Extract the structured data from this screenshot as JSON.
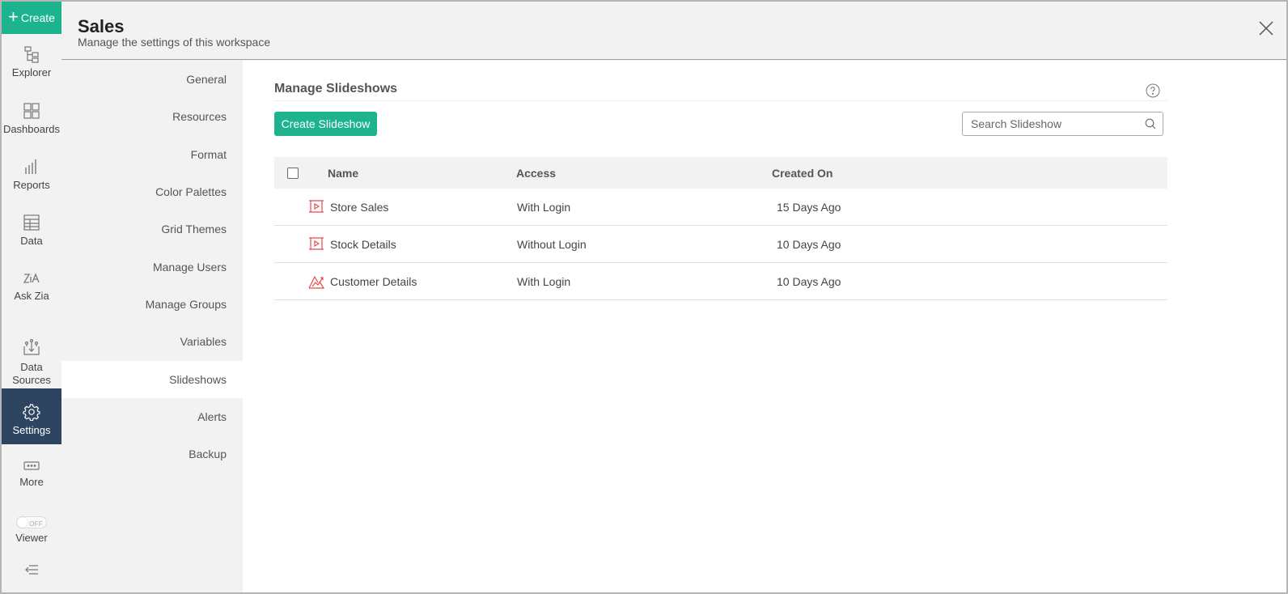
{
  "leftnav": {
    "create_label": "Create",
    "items": [
      {
        "label": "Explorer",
        "icon": "explorer-icon"
      },
      {
        "label": "Dashboards",
        "icon": "dashboards-icon"
      },
      {
        "label": "Reports",
        "icon": "reports-icon"
      },
      {
        "label": "Data",
        "icon": "data-table-icon"
      },
      {
        "label": "Ask Zia",
        "icon": "ask-zia-icon"
      },
      {
        "label": "Data Sources",
        "label_line1": "Data",
        "label_line2": "Sources",
        "icon": "data-sources-icon"
      },
      {
        "label": "Settings",
        "icon": "gear-icon",
        "active": true
      },
      {
        "label": "More",
        "icon": "more-icon"
      },
      {
        "label": "Viewer",
        "icon": "toggle-switch",
        "toggle_state": "OFF"
      }
    ],
    "collapse_icon": "collapse-menu-icon"
  },
  "header": {
    "title": "Sales",
    "subtitle": "Manage the settings of this workspace",
    "close_icon": "close-icon"
  },
  "settings_menu": {
    "items": [
      {
        "label": "General"
      },
      {
        "label": "Resources"
      },
      {
        "label": "Format"
      },
      {
        "label": "Color Palettes"
      },
      {
        "label": "Grid Themes"
      },
      {
        "label": "Manage Users"
      },
      {
        "label": "Manage Groups"
      },
      {
        "label": "Variables"
      },
      {
        "label": "Slideshows",
        "active": true
      },
      {
        "label": "Alerts"
      },
      {
        "label": "Backup"
      }
    ]
  },
  "main": {
    "section_title": "Manage Slideshows",
    "help_icon": "help-icon",
    "create_button": "Create Slideshow",
    "search": {
      "placeholder": "Search Slideshow",
      "value": ""
    },
    "table": {
      "columns": [
        "Name",
        "Access",
        "Created On"
      ],
      "rows": [
        {
          "name": "Store Sales",
          "icon": "slideshow-icon",
          "access": "With Login",
          "created_on": "15 Days Ago"
        },
        {
          "name": "Stock Details",
          "icon": "slideshow-icon",
          "access": "Without Login",
          "created_on": "10 Days Ago"
        },
        {
          "name": "Customer Details",
          "icon": "chart-slideshow-icon",
          "access": "With Login",
          "created_on": "10 Days Ago"
        }
      ]
    }
  },
  "colors": {
    "accent": "#1eb38f",
    "active_nav": "#2e4561",
    "row_icon": "#e84a4a"
  }
}
